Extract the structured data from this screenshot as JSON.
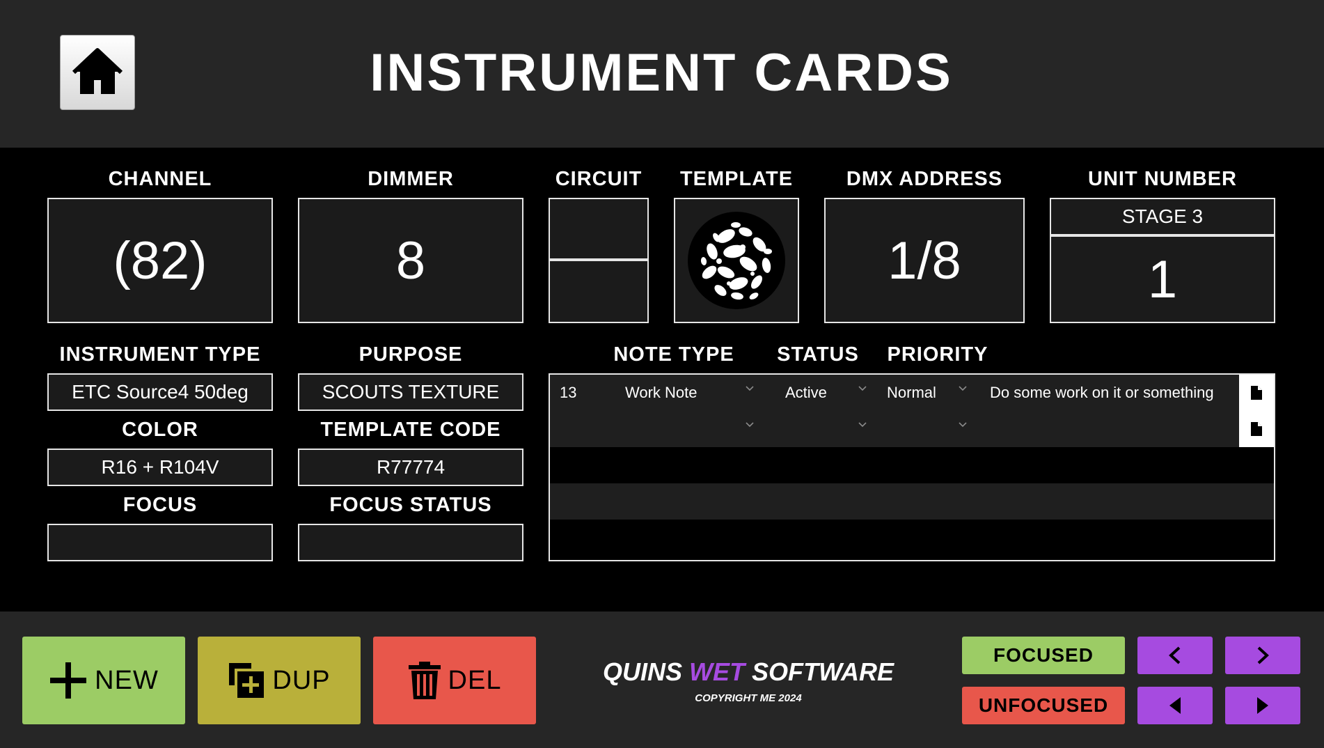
{
  "header": {
    "title": "INSTRUMENT CARDS",
    "home_icon": "home-icon"
  },
  "fields": {
    "channel": {
      "label": "CHANNEL",
      "value": "(82)"
    },
    "dimmer": {
      "label": "DIMMER",
      "value": "8"
    },
    "circuit": {
      "label": "CIRCUIT",
      "top_value": "",
      "bottom_value": ""
    },
    "template": {
      "label": "TEMPLATE",
      "image": "leafy-breakup-gobo"
    },
    "dmx_address": {
      "label": "DMX ADDRESS",
      "value": "1/8"
    },
    "unit_number": {
      "label": "UNIT NUMBER",
      "position": "STAGE 3",
      "value": "1"
    },
    "instrument_type": {
      "label": "INSTRUMENT TYPE",
      "value": "ETC Source4 50deg"
    },
    "purpose": {
      "label": "PURPOSE",
      "value": "SCOUTS TEXTURE"
    },
    "color": {
      "label": "COLOR",
      "value": "R16 + R104V"
    },
    "template_code": {
      "label": "TEMPLATE CODE",
      "value": "R77774"
    },
    "focus": {
      "label": "FOCUS",
      "value": ""
    },
    "focus_status": {
      "label": "FOCUS STATUS",
      "value": ""
    }
  },
  "notes": {
    "headers": {
      "type": "NOTE TYPE",
      "status": "STATUS",
      "priority": "PRIORITY"
    },
    "rows": [
      {
        "id": "13",
        "type": "Work Note",
        "status": "Active",
        "priority": "Normal",
        "text": "Do some work on it or something"
      },
      {
        "id": "",
        "type": "",
        "status": "",
        "priority": "",
        "text": ""
      }
    ]
  },
  "actions": {
    "new": "NEW",
    "dup": "DUP",
    "del": "DEL"
  },
  "branding": {
    "part1": "QUINS",
    "part2": "WET",
    "part3": "SOFTWARE",
    "copyright": "COPYRIGHT ME 2024"
  },
  "filters": {
    "focused": "FOCUSED",
    "unfocused": "UNFOCUSED"
  },
  "colors": {
    "new": "#9ccc65",
    "dup": "#b9b03a",
    "del": "#e8574b",
    "focused": "#9ccc65",
    "unfocused": "#e8574b",
    "nav": "#a64be0",
    "brand_accent": "#a64be0"
  }
}
